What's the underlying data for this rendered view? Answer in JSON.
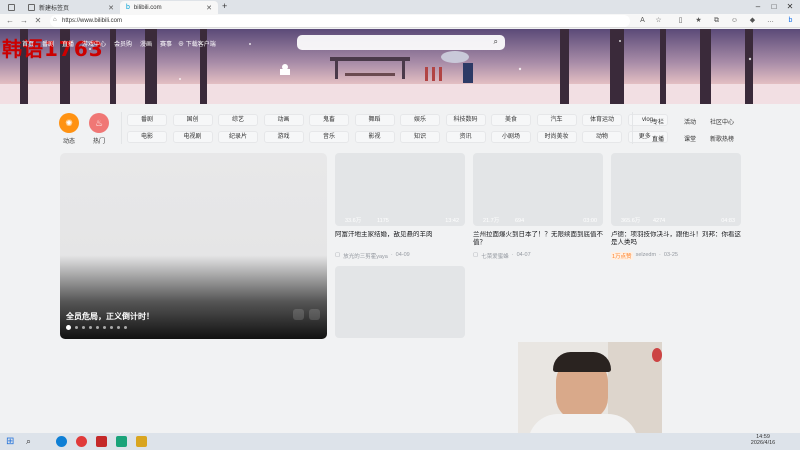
{
  "watermark": "韩语1763",
  "tabs": [
    {
      "label": "新建标签页",
      "active": false
    },
    {
      "label": "bilibili.com",
      "active": true
    }
  ],
  "browser": {
    "url": "https://www.bilibili.com",
    "new_tab": "+"
  },
  "header": {
    "nav": [
      "首页",
      "番剧",
      "直播",
      "游戏中心",
      "会员购",
      "漫画",
      "赛事"
    ],
    "download": "下载客户端",
    "search_placeholder": ""
  },
  "channels": {
    "dynamic": "动态",
    "hot": "热门",
    "row1": [
      "番剧",
      "国创",
      "综艺",
      "动画",
      "鬼畜",
      "舞蹈",
      "娱乐",
      "科技数码",
      "美食",
      "汽车",
      "体育运动",
      "vlog"
    ],
    "row2": [
      "电影",
      "电视剧",
      "纪录片",
      "游戏",
      "音乐",
      "影视",
      "知识",
      "资讯",
      "小剧场",
      "时尚美妆",
      "动物",
      "更多"
    ],
    "right1": [
      "专栏",
      "活动",
      "社区中心"
    ],
    "right2": [
      "直播",
      "课堂",
      "新歌热榜"
    ]
  },
  "featured": {
    "title": "全员危局，正义倒计时！",
    "dots": 9
  },
  "videos": [
    {
      "plays": "33.6万",
      "danmaku": "1175",
      "duration": "13:42",
      "title": "阿富汗地主家结婚，敌见悬的羊肉",
      "author": "放光的三剪霍yaya",
      "date": "04-09",
      "badge": ""
    },
    {
      "plays": "21.7万",
      "danmaku": "694",
      "duration": "03:00",
      "title": "兰州拉面爆火到日本了！？无限续面到底值不值？",
      "author": "七菜爱蜜蜂",
      "date": "04-07",
      "badge": ""
    },
    {
      "plays": "365.6万",
      "danmaku": "4274",
      "duration": "04:83",
      "title": "卢德：项羽技你决斗，跟他斗！刘邦：你看这是人类吗",
      "author": "selzedm",
      "date": "03-25",
      "badge": "1万点赞"
    }
  ],
  "taskbar": {
    "time": "14:59",
    "date": "2026/4/16"
  }
}
